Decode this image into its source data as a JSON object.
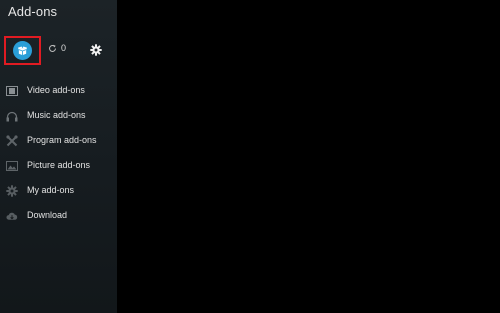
{
  "header": {
    "title": "Add-ons"
  },
  "toolbar": {
    "addon_browser_icon": "open-box-icon",
    "update_count": "0",
    "accent_color": "#2a9fd8",
    "highlight_color": "#e11b22"
  },
  "menu": {
    "items": [
      {
        "label": "Video add-ons",
        "icon": "film-icon"
      },
      {
        "label": "Music add-ons",
        "icon": "headphones-icon"
      },
      {
        "label": "Program add-ons",
        "icon": "tools-icon"
      },
      {
        "label": "Picture add-ons",
        "icon": "picture-icon"
      },
      {
        "label": "My add-ons",
        "icon": "gear-icon"
      },
      {
        "label": "Download",
        "icon": "cloud-download-icon"
      }
    ]
  }
}
